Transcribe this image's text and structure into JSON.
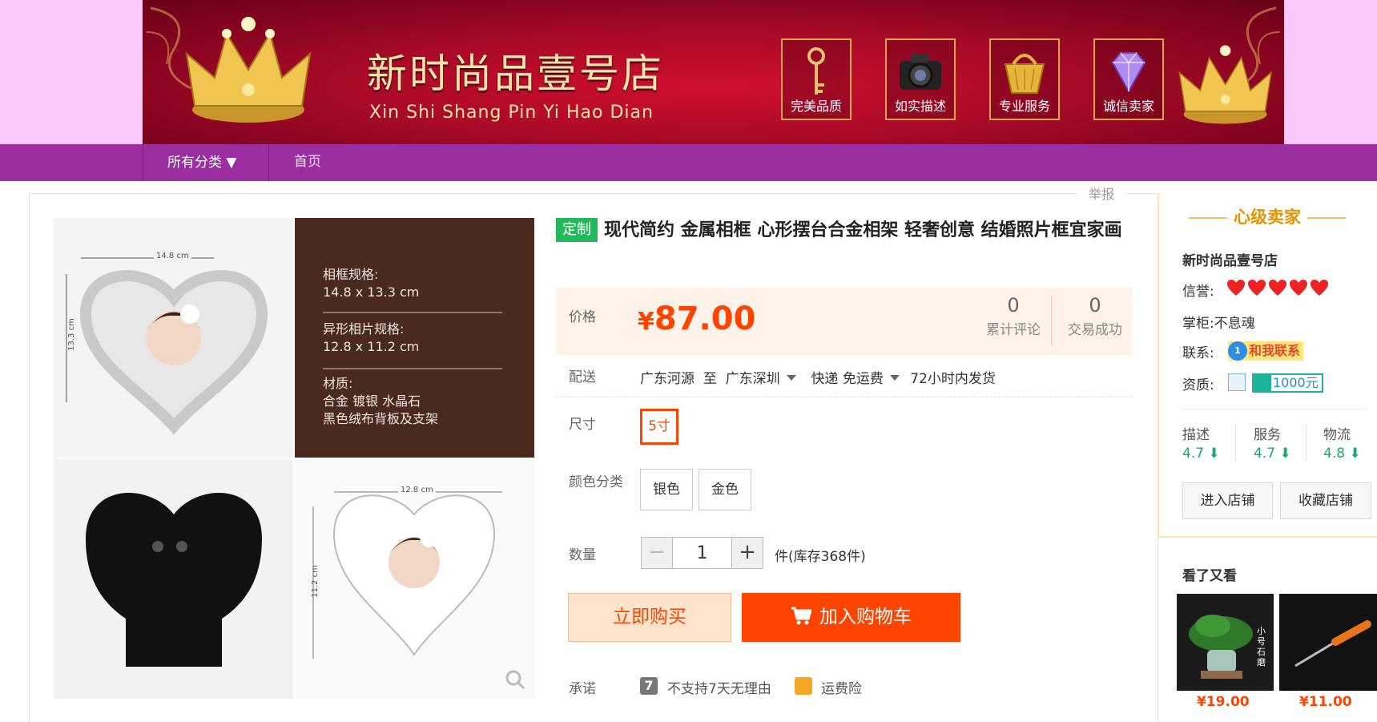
{
  "banner": {
    "shop_name": "新时尚品壹号店",
    "shop_pinyin": "Xin Shi Shang Pin Yi Hao Dian",
    "badges": [
      {
        "label": "完美品质",
        "icon": "key-icon"
      },
      {
        "label": "如实描述",
        "icon": "camera-icon"
      },
      {
        "label": "专业服务",
        "icon": "basket-icon"
      },
      {
        "label": "诚信卖家",
        "icon": "diamond-icon"
      }
    ]
  },
  "nav": {
    "all_categories": "所有分类 ▼",
    "home": "首页"
  },
  "report_label": "举报",
  "product": {
    "tag": "定制",
    "title": "现代简约 金属相框 心形摆台合金相架 轻奢创意 结婚照片框宜家画",
    "gallery_texts": {
      "frame_spec_label": "相框规格:",
      "frame_spec_value": "14.8 x 13.3 cm",
      "photo_spec_label": "异形相片规格:",
      "photo_spec_value": "12.8 x 11.2 cm",
      "material_label": "材质:",
      "material_line1": "合金  镀银  水晶石",
      "material_line2": "黑色绒布背板及支架",
      "dim_top": "14.8 cm",
      "dim_side": "13.3 cm",
      "dim_top2": "12.8 cm",
      "dim_side2": "11.2 cm"
    },
    "price_label": "价格",
    "currency": "¥",
    "price": "87.00",
    "reviews": {
      "count": "0",
      "label": "累计评论"
    },
    "sales": {
      "count": "0",
      "label": "交易成功"
    },
    "shipping": {
      "label": "配送",
      "from": "广东河源",
      "to_word": "至",
      "to": "广东深圳",
      "method": "快递 免运费",
      "dispatch": "72小时内发货"
    },
    "size": {
      "label": "尺寸",
      "options": [
        "5寸"
      ],
      "selected": "5寸"
    },
    "color": {
      "label": "颜色分类",
      "options": [
        "银色",
        "金色"
      ]
    },
    "quantity": {
      "label": "数量",
      "minus": "−",
      "value": "1",
      "plus": "+",
      "unit_stock": "件(库存368件)"
    },
    "buy_now": "立即购买",
    "add_to_cart": "加入购物车",
    "promise": {
      "label": "承诺",
      "items": [
        "不支持7天无理由",
        "运费险"
      ],
      "seven_icon_text": "7"
    }
  },
  "seller": {
    "level": "心级卖家",
    "shop_name": "新时尚品壹号店",
    "reputation_label": "信誉:",
    "reputation_hearts": 5,
    "owner_label": "掌柜:",
    "owner": "不息魂",
    "contact_label": "联系:",
    "contact_button": "和我联系",
    "contact_badge": "1",
    "qualification_label": "资质:",
    "deposit": "1000元",
    "scores": [
      {
        "label": "描述",
        "value": "4.7"
      },
      {
        "label": "服务",
        "value": "4.7"
      },
      {
        "label": "物流",
        "value": "4.8"
      }
    ],
    "enter_store": "进入店铺",
    "favorite_store": "收藏店铺"
  },
  "also_viewed": {
    "title": "看了又看",
    "items": [
      {
        "price": "¥19.00",
        "overlay_text": "小号石磨"
      },
      {
        "price": "¥11.00",
        "overlay_text": ""
      }
    ]
  },
  "colors": {
    "accent": "#ff4400",
    "nav": "#9b2ea0",
    "top_bg": "#fbc8fb",
    "tag_green": "#22b85c",
    "score_green": "#1aa87a",
    "seller_gold": "#e39500"
  }
}
